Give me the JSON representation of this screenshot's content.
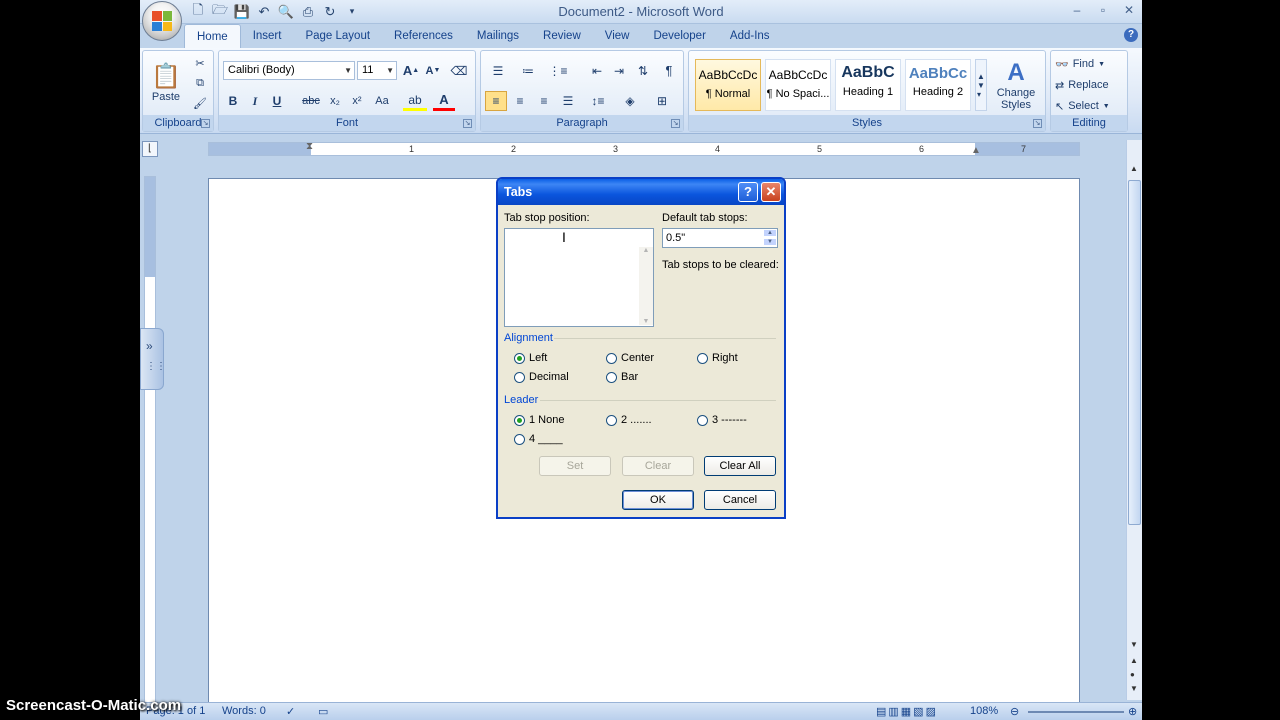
{
  "window": {
    "title": "Document2 - Microsoft Word",
    "controls": [
      "–",
      "▫",
      "✕"
    ]
  },
  "tabs": [
    "Home",
    "Insert",
    "Page Layout",
    "References",
    "Mailings",
    "Review",
    "View",
    "Developer",
    "Add-Ins"
  ],
  "ribbon": {
    "clipboard": {
      "group": "Clipboard",
      "paste": "Paste"
    },
    "font": {
      "group": "Font",
      "font_name": "Calibri (Body)",
      "font_size": "11",
      "bold": "B",
      "italic": "I",
      "underline": "U",
      "strike": "abc",
      "subscript": "x₂",
      "superscript": "x²",
      "change_case": "Aa"
    },
    "paragraph": {
      "group": "Paragraph"
    },
    "styles": {
      "group": "Styles",
      "items": [
        {
          "sample": "AaBbCcDc",
          "name": "¶ Normal"
        },
        {
          "sample": "AaBbCcDc",
          "name": "¶ No Spaci..."
        },
        {
          "sample": "AaBbC",
          "name": "Heading 1"
        },
        {
          "sample": "AaBbCc",
          "name": "Heading 2"
        }
      ],
      "change_styles": "Change Styles"
    },
    "editing": {
      "group": "Editing",
      "find": "Find",
      "replace": "Replace",
      "select": "Select"
    }
  },
  "ruler": {
    "numbers": [
      "1",
      "2",
      "3",
      "4",
      "5",
      "6",
      "7"
    ]
  },
  "status": {
    "page": "Page: 1 of 1",
    "words": "Words: 0",
    "zoom": "108%"
  },
  "watermark": "Screencast-O-Matic.com",
  "dialog": {
    "title": "Tabs",
    "tab_stop_label": "Tab stop position:",
    "tab_stop_value": "",
    "default_label": "Default tab stops:",
    "default_value": "0.5\"",
    "cleared_label": "Tab stops to be cleared:",
    "alignment_label": "Alignment",
    "alignment": [
      {
        "label": "Left",
        "selected": true
      },
      {
        "label": "Center",
        "selected": false
      },
      {
        "label": "Right",
        "selected": false
      },
      {
        "label": "Decimal",
        "selected": false
      },
      {
        "label": "Bar",
        "selected": false
      }
    ],
    "leader_label": "Leader",
    "leader": [
      {
        "label": "1 None",
        "selected": true
      },
      {
        "label": "2 .......",
        "selected": false
      },
      {
        "label": "3 -------",
        "selected": false
      },
      {
        "label": "4 ____",
        "selected": false
      }
    ],
    "buttons": {
      "set": "Set",
      "clear": "Clear",
      "clear_all": "Clear All",
      "ok": "OK",
      "cancel": "Cancel"
    }
  }
}
